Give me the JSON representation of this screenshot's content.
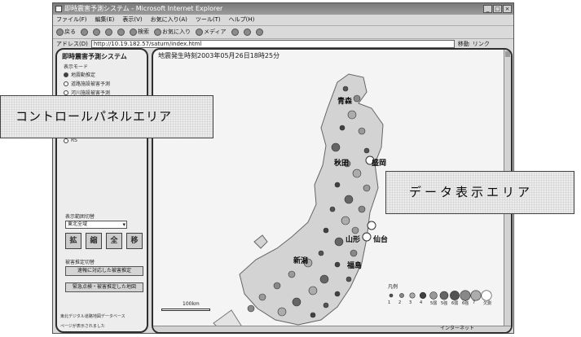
{
  "window": {
    "title": "即時震害予測システム - Microsoft Internet Explorer",
    "controls": [
      "_",
      "□",
      "×"
    ]
  },
  "menu": [
    "ファイル(F)",
    "編集(E)",
    "表示(V)",
    "お気に入り(A)",
    "ツール(T)",
    "ヘルプ(H)"
  ],
  "toolbar": {
    "back": "戻る",
    "search": "検索",
    "favorites": "お気に入り",
    "media": "メディア"
  },
  "address": {
    "label": "アドレス(D)",
    "url": "http://10.19.182.57/saturn/index.html",
    "go": "移動",
    "links": "リンク"
  },
  "control_panel": {
    "title": "即時震害予測システム",
    "display_mode_label": "表示モード",
    "radios": [
      {
        "label": "地震動推定",
        "selected": true
      },
      {
        "label": "道路施設被害予測",
        "selected": false
      },
      {
        "label": "河川施設被害予測",
        "selected": false
      },
      {
        "label": "RS",
        "selected": false
      }
    ],
    "area_label": "表示範囲切替",
    "area_value": "東北全域",
    "icon_buttons": [
      "拡",
      "縮",
      "全",
      "移"
    ],
    "section_label": "被害推定切替",
    "button1": "速報に対応した被害推定",
    "button2": "緊急点検・被害推定した地図",
    "footer1": "東北デジタル道路地図データベース",
    "footer2": "ページが表示されました"
  },
  "data_area": {
    "quake_time": "地震発生時刻2003年05月26日18時25分",
    "cities": [
      "青森",
      "秋田",
      "盛岡",
      "山形",
      "仙台",
      "福島",
      "新潟"
    ],
    "scale_text": "100km",
    "legend_title": "凡例",
    "legend_items": [
      "1",
      "2",
      "3",
      "4",
      "5弱",
      "5強",
      "6弱",
      "6強",
      "7",
      "欠測"
    ]
  },
  "status_bar": {
    "zone": "インターネット"
  },
  "callouts": {
    "left": "コントロールパネルエリア",
    "right": "データ表示エリア"
  }
}
